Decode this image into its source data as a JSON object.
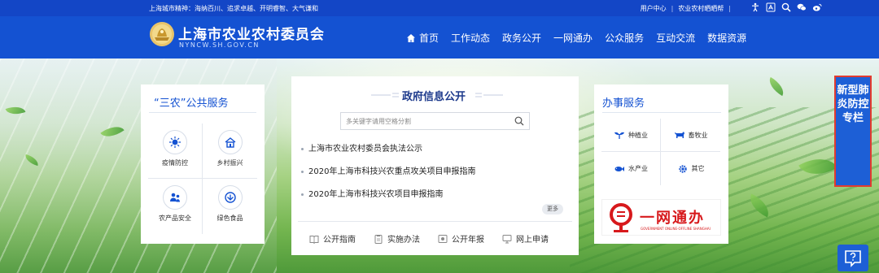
{
  "header": {
    "slogan": "上海城市精神：海纳百川、追求卓越、开明睿智、大气谦和",
    "top_links": [
      "用户中心",
      "农业农村晒晒帮"
    ],
    "icons": [
      "accessibility-icon",
      "elderly-mode-icon",
      "search-icon",
      "wechat-icon",
      "weibo-icon"
    ],
    "site_title": "上海市农业农村委员会",
    "site_domain": "NYNCW.SH.GOV.CN",
    "nav": [
      "首页",
      "工作动态",
      "政务公开",
      "一网通办",
      "公众服务",
      "互动交流",
      "数据资源"
    ]
  },
  "sanong": {
    "title": "“三农”公共服务",
    "items": [
      "疫情防控",
      "乡村振兴",
      "农产品安全",
      "绿色食品"
    ]
  },
  "zhengfu": {
    "title": "政府信息公开",
    "search_placeholder": "多关键字请用空格分割",
    "news": [
      "上海市农业农村委员会执法公示",
      "2020年上海市科技兴农重点攻关项目申报指南",
      "2020年上海市科技兴农项目申报指南"
    ],
    "more": "更多",
    "quick_links": [
      "公开指南",
      "实施办法",
      "公开年报",
      "网上申请"
    ]
  },
  "banshi": {
    "title": "办事服务",
    "items": [
      "种植业",
      "畜牧业",
      "水产业",
      "其它"
    ],
    "ywtb_text": "一网通办",
    "ywtb_sub": "GOVERNMENT ONLINE-OFFLINE SHANGHAI"
  },
  "side": {
    "covid_label": "新型肺炎防控专栏"
  },
  "colors": {
    "brand_blue": "#1452d2",
    "top_strip": "#1346c6",
    "ywtb_red": "#d7191c",
    "covid_border": "#e23b2f"
  }
}
